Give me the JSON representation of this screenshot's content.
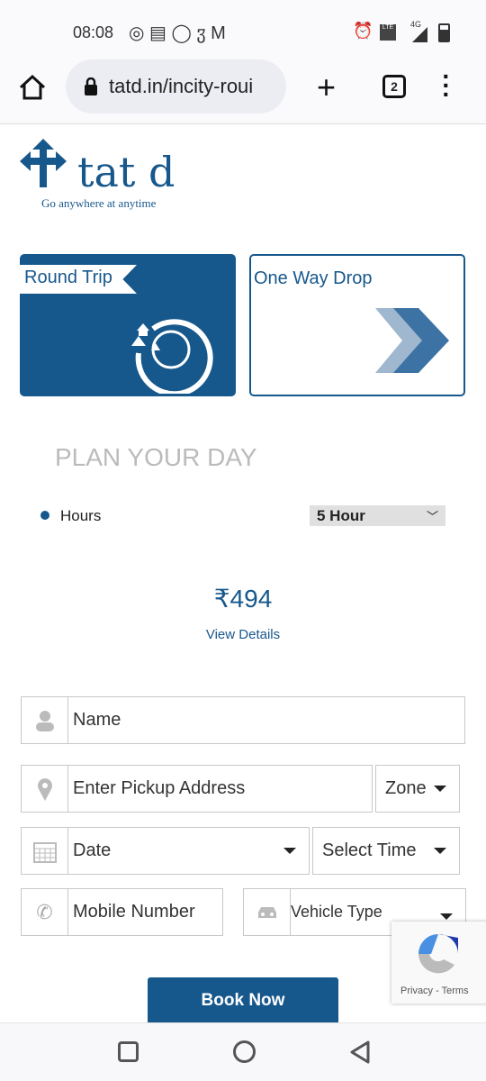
{
  "status_bar": {
    "time": "08:08",
    "network": "4G"
  },
  "browser": {
    "url": "tatd.in/incity-roui",
    "tab_count": "2"
  },
  "logo": {
    "name": "tat d",
    "tagline": "Go anywhere at anytime"
  },
  "trip_types": [
    {
      "label": "Round Trip",
      "selected": true
    },
    {
      "label": "One Way Drop",
      "selected": false
    }
  ],
  "plan": {
    "heading": "PLAN YOUR DAY",
    "option_label": "Hours",
    "hours_select": "5 Hour"
  },
  "price": {
    "currency": "₹",
    "amount": "494",
    "details_link": "View Details"
  },
  "form": {
    "name_placeholder": "Name",
    "pickup_placeholder": "Enter Pickup Address",
    "zone": "Zone",
    "date": "Date",
    "time": "Select Time",
    "mobile_placeholder": "Mobile Number",
    "vehicle": "Vehicle Type",
    "submit": "Book Now"
  },
  "recaptcha": {
    "privacy": "Privacy",
    "sep": " - ",
    "terms": "Terms"
  },
  "colors": {
    "brand": "#17588c",
    "field_border": "#c8c8c8"
  }
}
